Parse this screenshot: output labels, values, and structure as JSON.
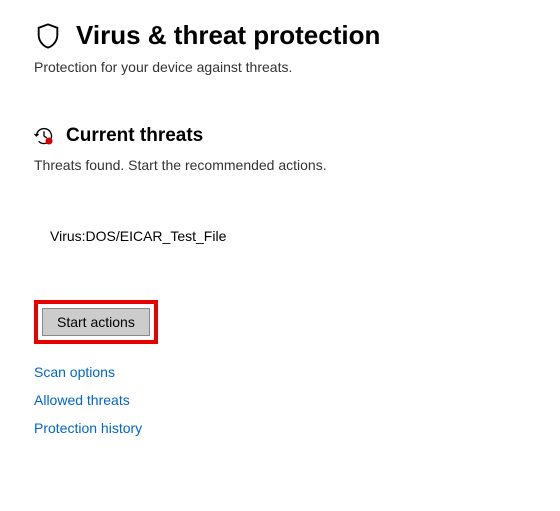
{
  "header": {
    "title": "Virus & threat protection",
    "subtitle": "Protection for your device against threats."
  },
  "section": {
    "title": "Current threats",
    "description": "Threats found. Start the recommended actions."
  },
  "threats": {
    "items": [
      {
        "name": "Virus:DOS/EICAR_Test_File"
      }
    ]
  },
  "actions": {
    "start_label": "Start actions"
  },
  "links": {
    "scan_options": "Scan options",
    "allowed_threats": "Allowed threats",
    "protection_history": "Protection history"
  }
}
